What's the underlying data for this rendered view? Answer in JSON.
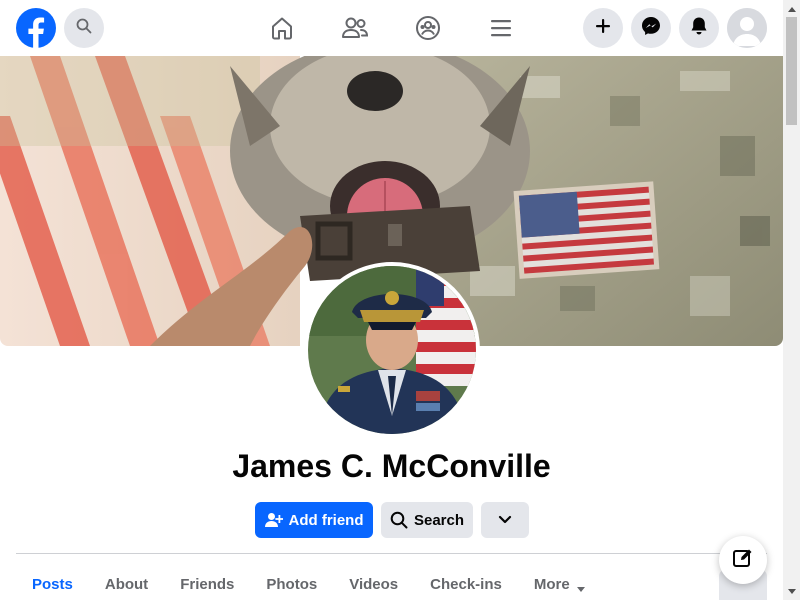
{
  "topbar": {
    "logo_icon": "facebook-logo",
    "search_icon": "search-icon",
    "nav": [
      "home-icon",
      "friends-icon",
      "groups-icon",
      "menu-icon"
    ],
    "right": [
      "create-plus-icon",
      "messenger-icon",
      "notifications-bell-icon",
      "account-avatar"
    ]
  },
  "profile": {
    "name": "James C. McConville"
  },
  "actions": {
    "add_friend": "Add friend",
    "search": "Search"
  },
  "tabs": [
    {
      "label": "Posts",
      "active": true
    },
    {
      "label": "About"
    },
    {
      "label": "Friends"
    },
    {
      "label": "Photos"
    },
    {
      "label": "Videos"
    },
    {
      "label": "Check-ins"
    },
    {
      "label": "More"
    }
  ],
  "colors": {
    "brand": "#0866ff",
    "button_bg": "#e4e6eb",
    "text": "#050505",
    "muted": "#65676b"
  }
}
